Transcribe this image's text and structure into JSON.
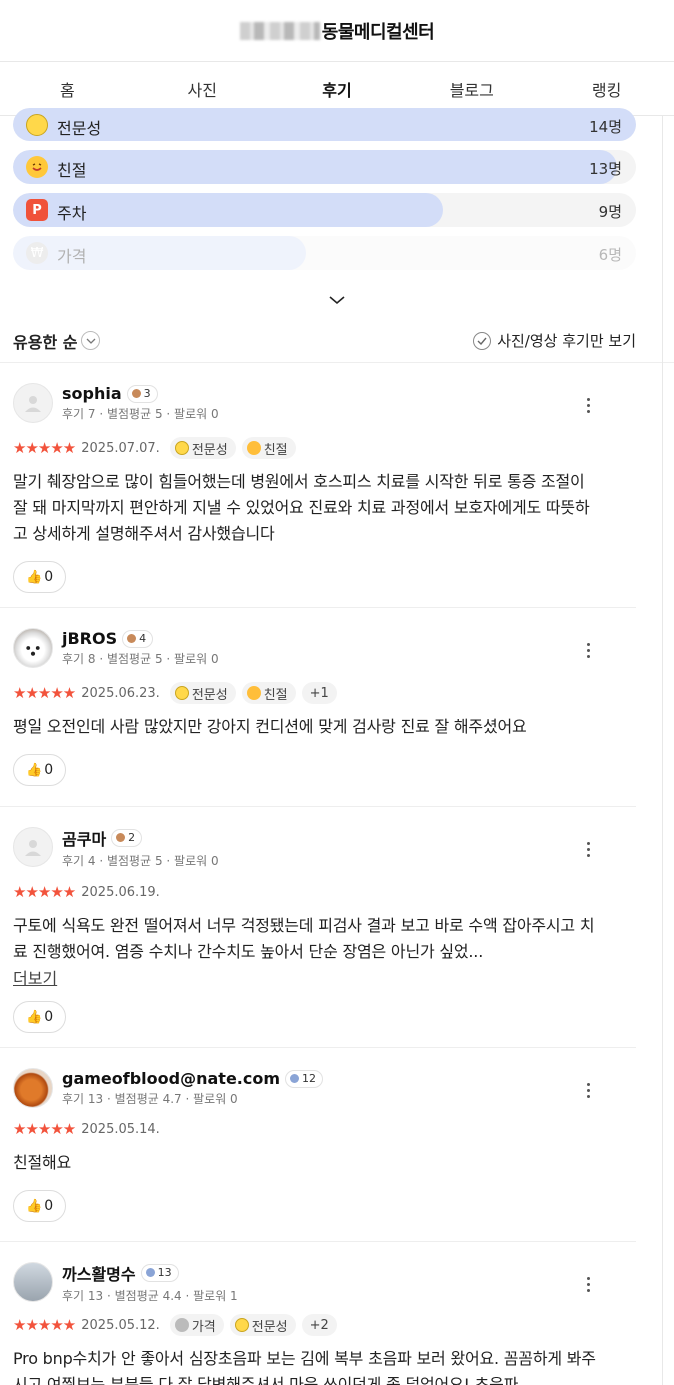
{
  "header": {
    "title": "동물메디컬센터"
  },
  "tabs": [
    {
      "label": "홈"
    },
    {
      "label": "사진"
    },
    {
      "label": "후기",
      "active": true
    },
    {
      "label": "블로그"
    },
    {
      "label": "랭킹"
    }
  ],
  "keywords": [
    {
      "label": "전문성",
      "count": "14명",
      "level": 1.0,
      "icon": "nerd-face-icon"
    },
    {
      "label": "친절",
      "count": "13명",
      "level": 0.97,
      "icon": "smile-face-icon"
    },
    {
      "label": "주차",
      "count": "9명",
      "level": 0.69,
      "icon": "parking-icon"
    },
    {
      "label": "가격",
      "count": "6명",
      "level": 0.47,
      "icon": "won-icon"
    }
  ],
  "sort": {
    "label": "유용한 순",
    "filter_label": "사진/영상 후기만 보기"
  },
  "reviews": [
    {
      "name": "sophia",
      "level": "3",
      "meta": "후기 7 · 별점평균 5 · 팔로워 0",
      "stars": "★★★★★",
      "rating": 5,
      "date": "2025.07.07.",
      "tags": [
        "전문성",
        "친절"
      ],
      "text": "말기 췌장암으로 많이 힘들어했는데 병원에서 호스피스 치료를 시작한 뒤로 통증 조절이 잘 돼 마지막까지 편안하게 지낼 수 있었어요 진료와 치료 과정에서 보호자에게도 따뜻하고 상세하게 설명해주셔서 감사했습니다",
      "likes": "0"
    },
    {
      "name": "jBROS",
      "level": "4",
      "meta": "후기 8 · 별점평균 5 · 팔로워 0",
      "stars": "★★★★★",
      "rating": 5,
      "date": "2025.06.23.",
      "tags": [
        "전문성",
        "친절"
      ],
      "extra_tags": "+1",
      "text": "평일 오전인데 사람 많았지만 강아지 컨디션에 맞게 검사랑 진료 잘 해주셨어요",
      "likes": "0"
    },
    {
      "name": "곰쿠마",
      "level": "2",
      "meta": "후기 4 · 별점평균 5 · 팔로워 0",
      "stars": "★★★★★",
      "rating": 5,
      "date": "2025.06.19.",
      "text": "구토에 식욕도 완전 떨어져서 너무 걱정됐는데 피검사 결과 보고 바로 수액 잡아주시고 치료 진행했어여. 염증 수치나 간수치도 높아서 단순 장염은 아닌가 싶었...",
      "more_label": "더보기",
      "likes": "0"
    },
    {
      "name": "gameofblood@nate.com",
      "level": "12",
      "meta": "후기 13 · 별점평균 4.7 · 팔로워 0",
      "stars": "★★★★★",
      "rating": 5,
      "date": "2025.05.14.",
      "text": "친절해요",
      "likes": "0"
    },
    {
      "name": "까스활명수",
      "level": "13",
      "meta": "후기 13 · 별점평균 4.4 · 팔로워 1",
      "stars": "★★★★★",
      "rating": 5,
      "date": "2025.05.12.",
      "tags": [
        "가격",
        "전문성"
      ],
      "extra_tags": "+2",
      "text": "Pro bnp수치가 안 좋아서 심장초음파 보는 김에 복부 초음파 보러 왔어요. 꼼꼼하게 봐주시고 여쭤보는 부분들 다 잘 답변해주셔서 마음 쓰이던게 좀 덜었어요! 초음파"
    }
  ]
}
